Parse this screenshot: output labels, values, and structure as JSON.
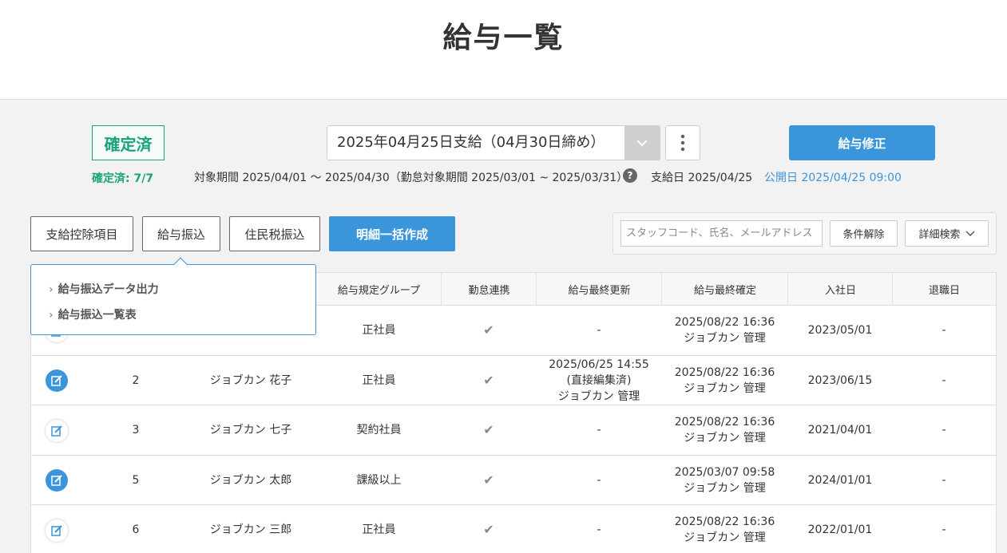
{
  "page": {
    "title": "給与一覧"
  },
  "status": {
    "badge": "確定済",
    "count_text": "確定済: 7/7"
  },
  "payday_select": {
    "value": "2025年04月25日支給（04月30日締め）"
  },
  "actions": {
    "payroll_fix": "給与修正"
  },
  "info": {
    "period": "対象期間 2025/04/01 〜 2025/04/30（勤怠対象期間 2025/03/01 ~ 2025/03/31）",
    "help": "?",
    "payday": "支給日 2025/04/25",
    "published": "公開日 2025/04/25 09:00"
  },
  "toolbar": {
    "deduction_items": "支給控除項目",
    "salary_transfer": "給与振込",
    "resident_tax_transfer": "住民税振込",
    "bulk_create": "明細一括作成"
  },
  "search": {
    "placeholder": "スタッフコード、氏名、メールアドレス",
    "clear": "条件解除",
    "advanced": "詳細検索"
  },
  "dropdown": {
    "items": [
      "給与振込データ出力",
      "給与振込一覧表"
    ]
  },
  "table": {
    "headers": [
      "給与規定グループ",
      "勤怠連携",
      "給与最終更新",
      "給与最終確定",
      "入社日",
      "退職日"
    ],
    "rows": [
      {
        "no": "",
        "name": "",
        "group": "正社員",
        "attendance": "✔",
        "updated": [
          "-"
        ],
        "confirmed": [
          "2025/08/22 16:36",
          "ジョブカン 管理"
        ],
        "joined": "2023/05/01",
        "retired": "-",
        "icon": "outline"
      },
      {
        "no": "2",
        "name": "ジョブカン 花子",
        "group": "正社員",
        "attendance": "✔",
        "updated": [
          "2025/06/25 14:55",
          "(直接編集済)",
          "ジョブカン 管理"
        ],
        "confirmed": [
          "2025/08/22 16:36",
          "ジョブカン 管理"
        ],
        "joined": "2023/06/15",
        "retired": "-",
        "icon": "filled"
      },
      {
        "no": "3",
        "name": "ジョブカン 七子",
        "group": "契約社員",
        "attendance": "✔",
        "updated": [
          "-"
        ],
        "confirmed": [
          "2025/08/22 16:36",
          "ジョブカン 管理"
        ],
        "joined": "2021/04/01",
        "retired": "-",
        "icon": "outline"
      },
      {
        "no": "5",
        "name": "ジョブカン 太郎",
        "group": "課級以上",
        "attendance": "✔",
        "updated": [
          "-"
        ],
        "confirmed": [
          "2025/03/07 09:58",
          "ジョブカン 管理"
        ],
        "joined": "2024/01/01",
        "retired": "-",
        "icon": "filled"
      },
      {
        "no": "6",
        "name": "ジョブカン 三郎",
        "group": "正社員",
        "attendance": "✔",
        "updated": [
          "-"
        ],
        "confirmed": [
          "2025/08/22 16:36",
          "ジョブカン 管理"
        ],
        "joined": "2022/01/01",
        "retired": "-",
        "icon": "outline"
      }
    ]
  },
  "colors": {
    "accent": "#3a95da",
    "confirmed": "#1aa37a"
  }
}
